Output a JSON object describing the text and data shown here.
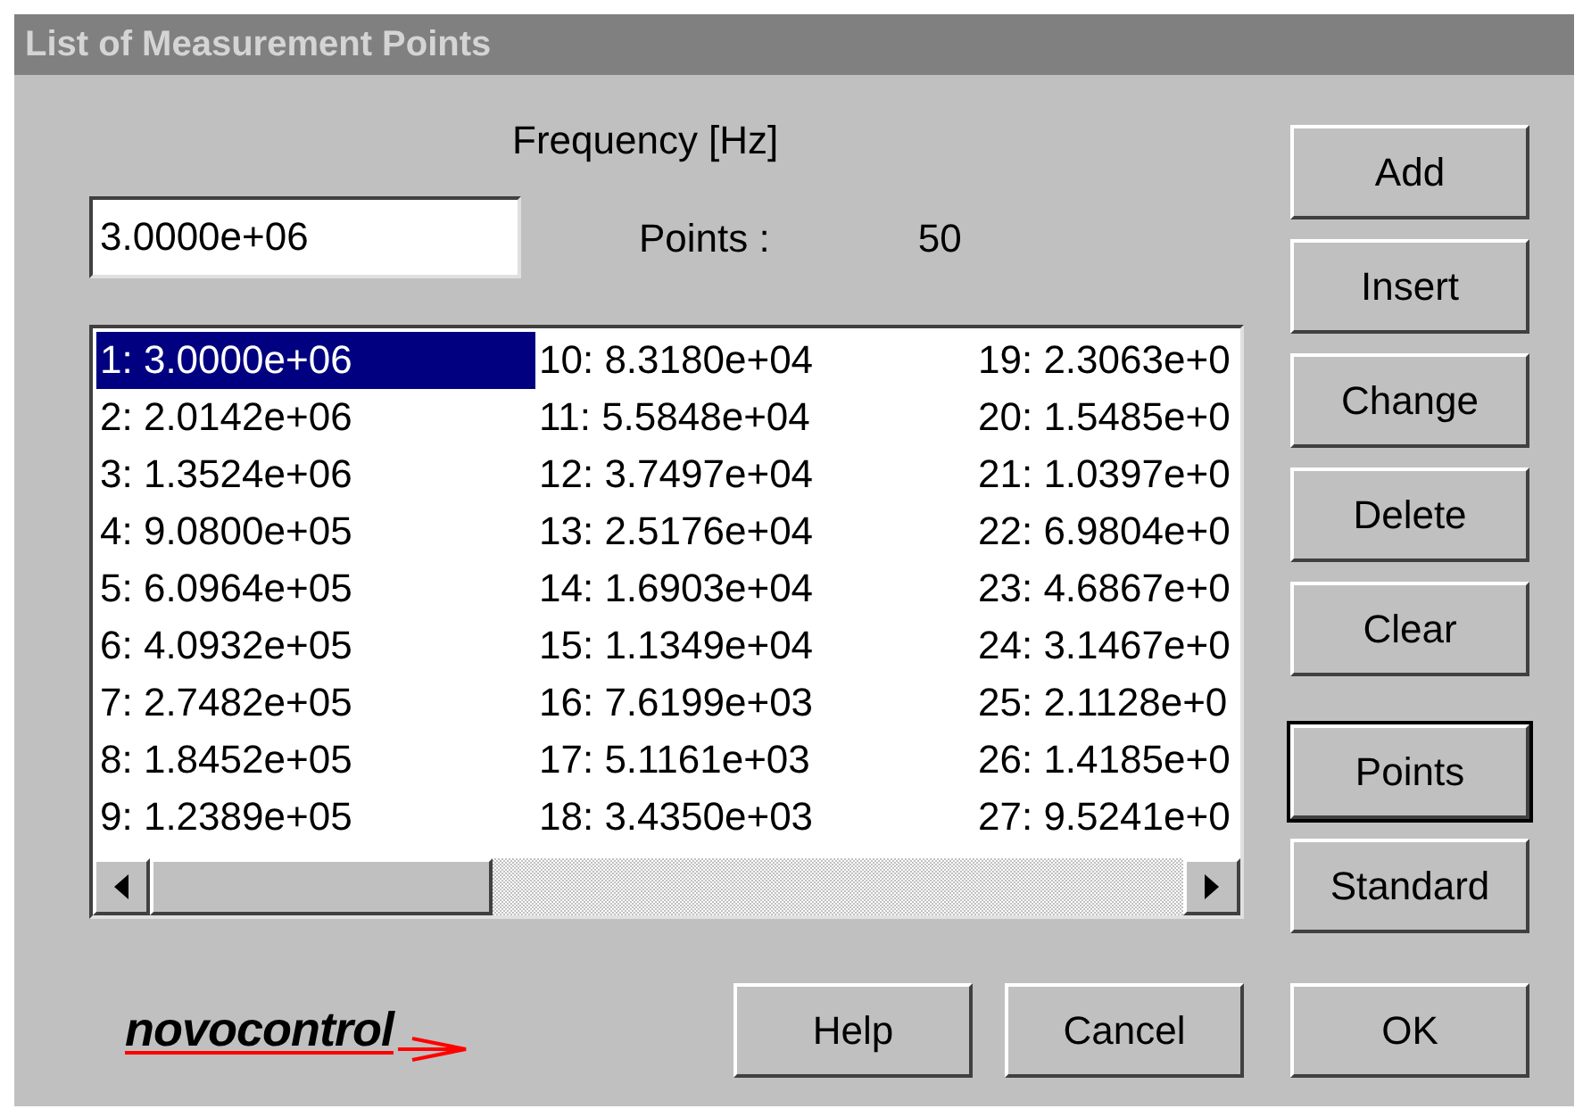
{
  "window": {
    "title": "List of Measurement Points"
  },
  "frequency": {
    "label": "Frequency [Hz]",
    "value": "3.0000e+06"
  },
  "points": {
    "label": "Points :",
    "value": "50"
  },
  "list": {
    "items": [
      {
        "text": "1: 3.0000e+06",
        "selected": true
      },
      {
        "text": "2: 2.0142e+06",
        "selected": false
      },
      {
        "text": "3: 1.3524e+06",
        "selected": false
      },
      {
        "text": "4: 9.0800e+05",
        "selected": false
      },
      {
        "text": "5: 6.0964e+05",
        "selected": false
      },
      {
        "text": "6: 4.0932e+05",
        "selected": false
      },
      {
        "text": "7: 2.7482e+05",
        "selected": false
      },
      {
        "text": "8: 1.8452e+05",
        "selected": false
      },
      {
        "text": "9: 1.2389e+05",
        "selected": false
      },
      {
        "text": "10: 8.3180e+04",
        "selected": false
      },
      {
        "text": "11: 5.5848e+04",
        "selected": false
      },
      {
        "text": "12: 3.7497e+04",
        "selected": false
      },
      {
        "text": "13: 2.5176e+04",
        "selected": false
      },
      {
        "text": "14: 1.6903e+04",
        "selected": false
      },
      {
        "text": "15: 1.1349e+04",
        "selected": false
      },
      {
        "text": "16: 7.6199e+03",
        "selected": false
      },
      {
        "text": "17: 5.1161e+03",
        "selected": false
      },
      {
        "text": "18: 3.4350e+03",
        "selected": false
      },
      {
        "text": "19: 2.3063e+0",
        "selected": false
      },
      {
        "text": "20: 1.5485e+0",
        "selected": false
      },
      {
        "text": "21: 1.0397e+0",
        "selected": false
      },
      {
        "text": "22: 6.9804e+0",
        "selected": false
      },
      {
        "text": "23: 4.6867e+0",
        "selected": false
      },
      {
        "text": "24: 3.1467e+0",
        "selected": false
      },
      {
        "text": "25: 2.1128e+0",
        "selected": false
      },
      {
        "text": "26: 1.4185e+0",
        "selected": false
      },
      {
        "text": "27: 9.5241e+0",
        "selected": false
      }
    ]
  },
  "side_buttons": [
    {
      "label": "Add",
      "default": false
    },
    {
      "label": "Insert",
      "default": false
    },
    {
      "label": "Change",
      "default": false
    },
    {
      "label": "Delete",
      "default": false
    },
    {
      "label": "Clear",
      "default": false
    },
    {
      "label": "Points",
      "default": true
    },
    {
      "label": "Standard",
      "default": false
    }
  ],
  "logo": {
    "text": "novocontrol"
  },
  "bottom_buttons": [
    {
      "label": "Help",
      "default": false
    },
    {
      "label": "Cancel",
      "default": false
    },
    {
      "label": "OK",
      "default": false
    }
  ]
}
